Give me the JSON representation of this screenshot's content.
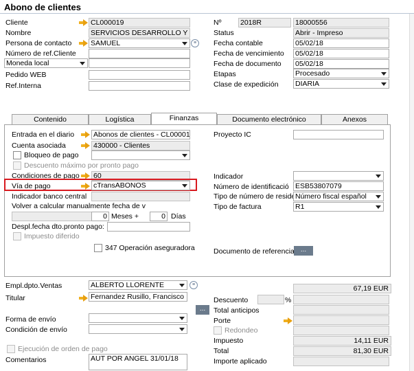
{
  "window_title": "Abono de clientes",
  "header_left": {
    "cliente_label": "Cliente",
    "cliente_value": "CL000019",
    "nombre_label": "Nombre",
    "nombre_value": "SERVICIOS DESARROLLO Y SG",
    "persona_label": "Persona de contacto",
    "persona_value": "SAMUEL",
    "ref_label": "Número de ref.Cliente",
    "ref_value": "",
    "moneda_value": "Moneda local",
    "moneda_input": "",
    "pedido_label": "Pedido WEB",
    "pedido_value": "",
    "refint_label": "Ref.Interna",
    "refint_value": ""
  },
  "header_right": {
    "no_label": "Nº",
    "series_value": "2018R",
    "number_value": "18000556",
    "status_label": "Status",
    "status_value": "Abrir - Impreso",
    "fecha_contable_label": "Fecha contable",
    "fecha_contable_value": "05/02/18",
    "fecha_venc_label": "Fecha de vencimiento",
    "fecha_venc_value": "05/02/18",
    "fecha_doc_label": "Fecha de documento",
    "fecha_doc_value": "05/02/18",
    "etapas_label": "Etapas",
    "etapas_value": "Procesado",
    "clase_label": "Clase de expedición",
    "clase_value": "DIARIA"
  },
  "tabs": [
    "Contenido",
    "Logística",
    "Finanzas",
    "Documento electrónico",
    "Anexos"
  ],
  "finanzas": {
    "entrada_label": "Entrada en el diario",
    "entrada_value": "Abonos de clientes - CL000019",
    "cuenta_label": "Cuenta asociada",
    "cuenta_value": "430000 - Clientes",
    "bloqueo_label": "Bloqueo de pago",
    "bloqueo_value": "",
    "descuento_label": "Descuento máximo por pronto pago",
    "condiciones_label": "Condiciones de pago",
    "condiciones_value": "60",
    "via_label": "Vía de pago",
    "via_value": "cTransABONOS",
    "indicador_banco_label": "Indicador banco central",
    "indicador_banco_value": "",
    "volver_label": "Volver a calcular manualmente fecha de v",
    "volver_value": "",
    "meses_value": "0",
    "meses_label": "Meses +",
    "dias_value": "0",
    "dias_label": "Días",
    "despl_label": "Despl.fecha dto.pronto pago:",
    "despl_value": "",
    "impuesto_label": "Impuesto diferido",
    "op347_label": "347 Operación aseguradora",
    "proyecto_label": "Proyecto IC",
    "proyecto_value": "",
    "indicador_label": "Indicador",
    "indicador_value": "",
    "numid_label": "Número de identificació",
    "numid_value": "ESB53807079",
    "tipo_num_label": "Tipo de número de reside",
    "tipo_num_value": "Número fiscal español",
    "tipo_fact_label": "Tipo de factura",
    "tipo_fact_value": "R1",
    "docref_label": "Documento de referencia",
    "docref_button": "..."
  },
  "footer_left": {
    "empl_label": "Empl.dpto.Ventas",
    "empl_value": "ALBERTO LLORENTE",
    "titular_label": "Titular",
    "titular_value": "Fernandez Rusillo, Francisco",
    "forma_label": "Forma de envío",
    "forma_value": "",
    "condicion_label": "Condición de envío",
    "condicion_value": "",
    "ejecucion_label": "Ejecución de orden de pago",
    "comentarios_label": "Comentarios",
    "comentarios_value": "AUT POR ANGEL 31/01/18"
  },
  "footer_right": {
    "total_top_value": "67,19 EUR",
    "more_button": "...",
    "descuento_label": "Descuento",
    "descuento_pct": "",
    "pct_sign": "%",
    "descuento_value": "",
    "total_anticipos_label": "Total anticipos",
    "total_anticipos_value": "",
    "porte_label": "Porte",
    "porte_value": "",
    "redondeo_label": "Redondeo",
    "redondeo_value": "",
    "impuesto_label": "Impuesto",
    "impuesto_value": "14,11 EUR",
    "total_label": "Total",
    "total_value": "81,30 EUR",
    "importe_label": "Importe aplicado",
    "importe_value": ""
  }
}
